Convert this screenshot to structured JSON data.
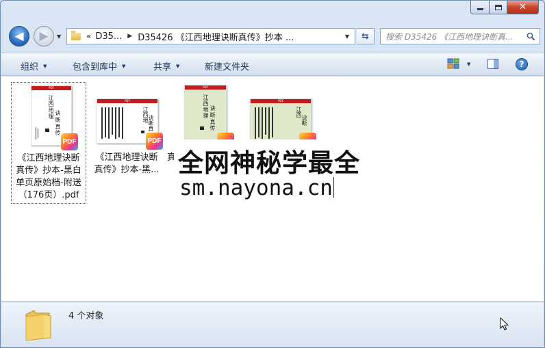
{
  "window": {
    "caption": {
      "minimize": "minimize",
      "maximize": "maximize",
      "close": "close"
    }
  },
  "nav": {
    "breadcrumb_overflow": "«",
    "crumbs": [
      "D35...",
      "D35426 《江西地理诀断真传》抄本 ..."
    ],
    "search_placeholder": "搜索 D35426 《江西地理诀断真..."
  },
  "toolbar": {
    "organize": "组织",
    "include_in_library": "包含到库中",
    "share": "共享",
    "new_folder": "新建文件夹"
  },
  "files": [
    {
      "name": "《江西地理诀断真传》抄本-黑白单页原始档-附送（176页）.pdf",
      "badge": "PDF",
      "selected": true
    },
    {
      "name": "《江西地理诀断真传》抄本-黑...",
      "badge": "PDF",
      "selected": false
    },
    {
      "name": "真",
      "badge": "",
      "selected": false
    },
    {
      "name": "",
      "badge": "",
      "selected": false
    }
  ],
  "file_labels": {
    "f1_line1": "《江西地理诀断",
    "f1_line2": "真传》抄本-黑白",
    "f1_line3": "单页原始档-附送",
    "f1_line4": "（176页）.pdf",
    "f2_line1": "《江西地理诀断",
    "f2_line2": "真传》抄本-黑...",
    "f3_fragment": "真"
  },
  "watermark": {
    "line1": "全网神秘学最全",
    "line2": "sm.nayona.cn"
  },
  "status": {
    "object_count": "4 个对象"
  },
  "icons": [
    "back-arrow-icon",
    "forward-arrow-icon",
    "folder-icon",
    "refresh-icon",
    "search-icon",
    "view-options-icon",
    "preview-pane-icon",
    "help-icon",
    "pdf-badge-icon",
    "mouse-cursor-icon"
  ]
}
